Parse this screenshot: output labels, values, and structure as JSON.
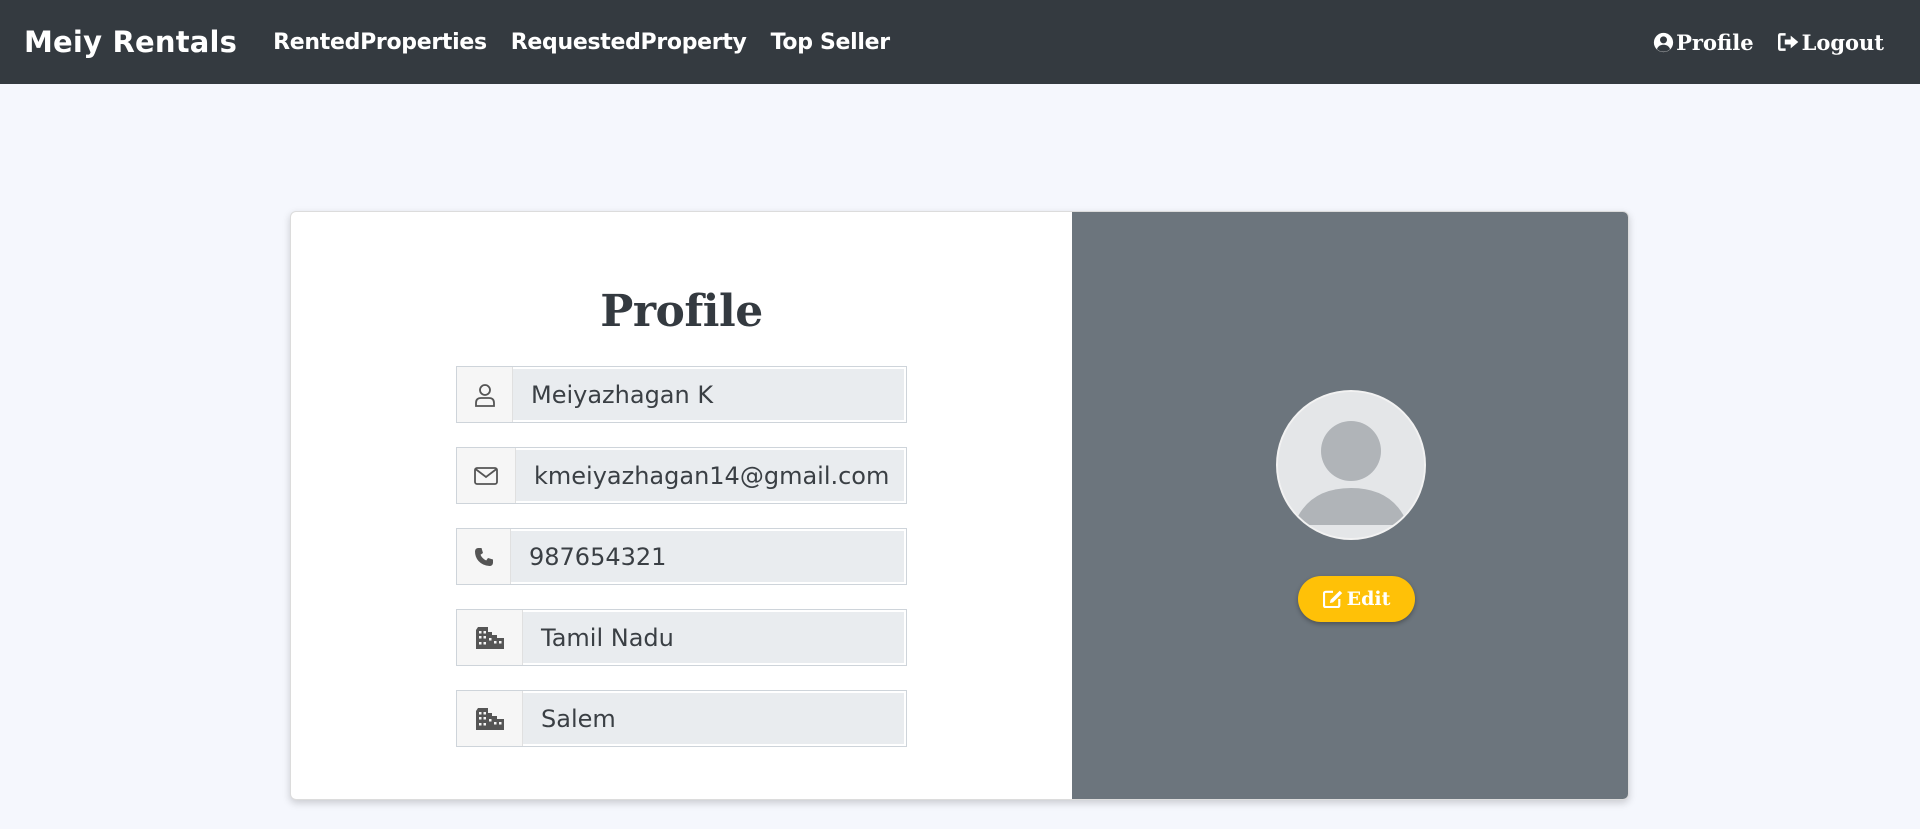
{
  "navbar": {
    "brand": "Meiy Rentals",
    "links": [
      "RentedProperties",
      "RequestedProperty",
      "Top Seller"
    ],
    "profile_label": "Profile",
    "logout_label": "Logout",
    "profile_icon": "user-circle-icon",
    "logout_icon": "sign-out-icon",
    "background": "#343a40"
  },
  "profile": {
    "title": "Profile",
    "fields": [
      {
        "icon": "user-icon",
        "value": "Meiyazhagan K"
      },
      {
        "icon": "envelope-icon",
        "value": "kmeiyazhagan14@gmail.com"
      },
      {
        "icon": "phone-icon",
        "value": "987654321"
      },
      {
        "icon": "building-icon",
        "value": "Tamil Nadu"
      },
      {
        "icon": "building-icon",
        "value": "Salem"
      }
    ],
    "avatar_icon": "default-avatar-icon",
    "edit_label": "Edit",
    "edit_icon": "edit-icon",
    "edit_color": "#ffc107",
    "panel_color": "#6c757d"
  }
}
